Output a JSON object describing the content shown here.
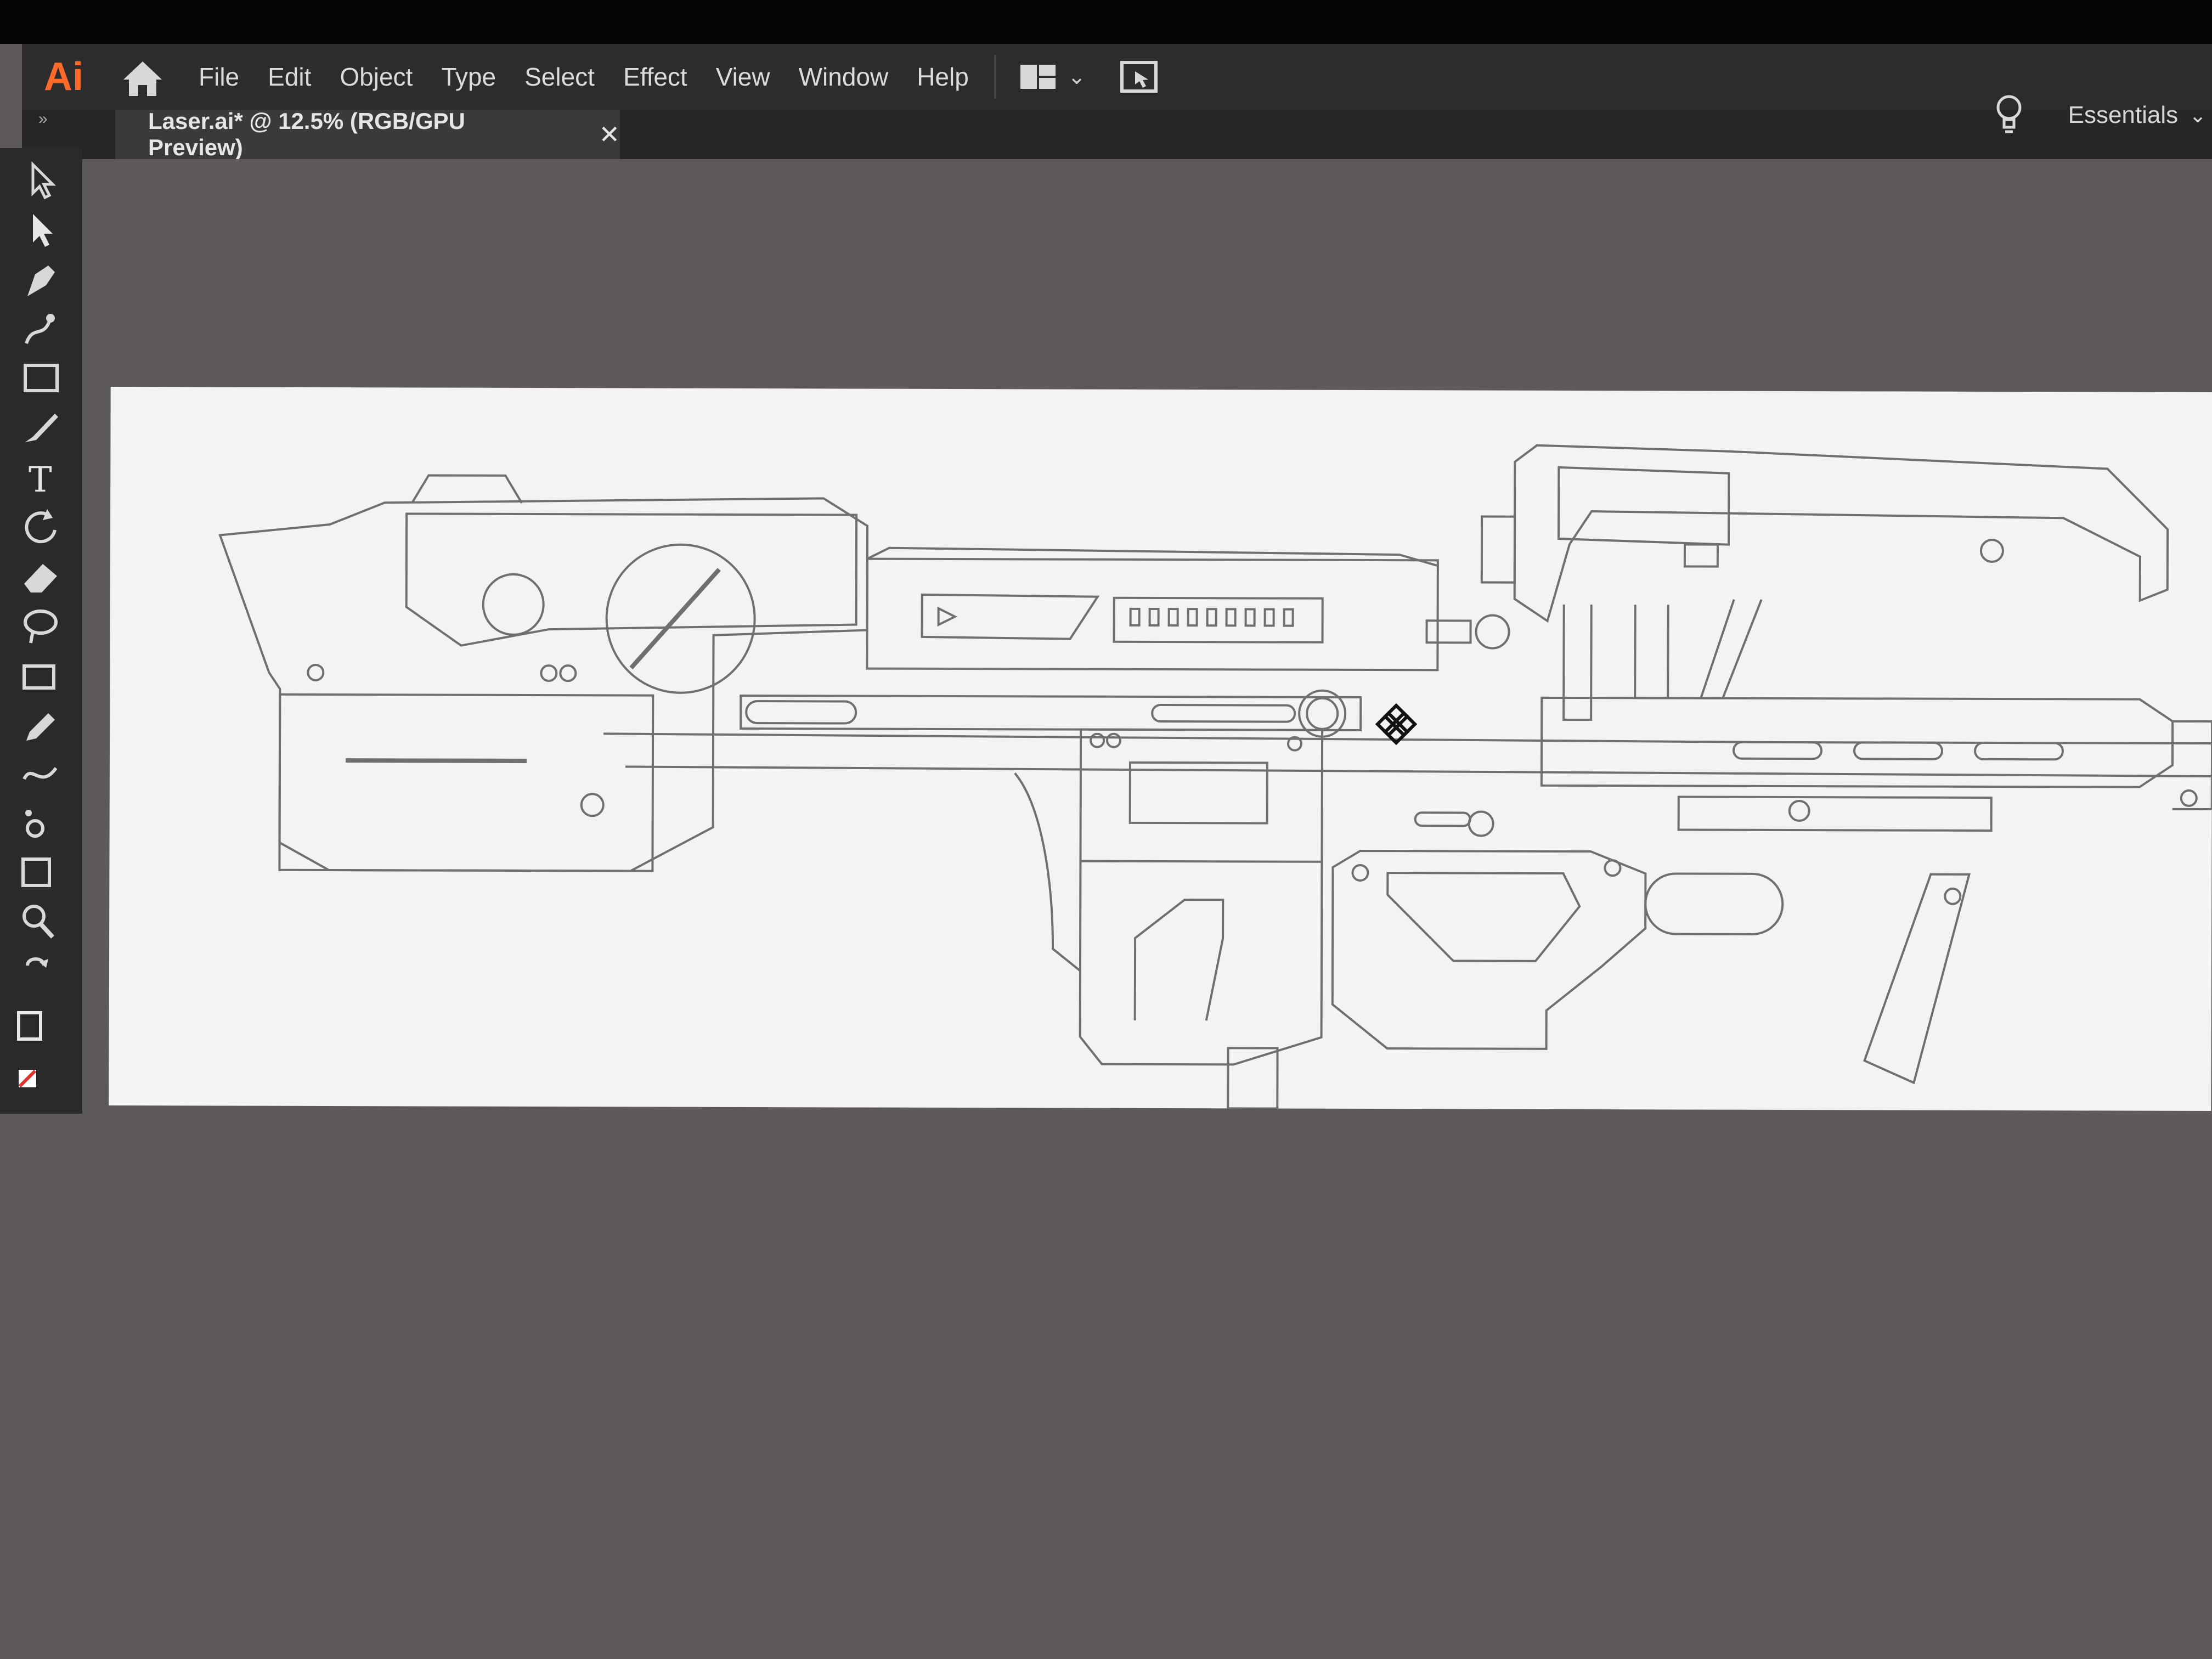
{
  "app": {
    "logo": "Ai"
  },
  "menu": [
    "File",
    "Edit",
    "Object",
    "Type",
    "Select",
    "Effect",
    "View",
    "Window",
    "Help"
  ],
  "document_tab": {
    "title": "Laser.ai* @ 12.5% (RGB/GPU Preview)",
    "close": "✕"
  },
  "workspace": {
    "label": "Essentials",
    "chevron": "⌄"
  },
  "icons": {
    "home": "home-icon",
    "workspace_switcher": "workspace-switcher-icon",
    "arrange": "arrange-documents-icon",
    "discover": "lightbulb-icon"
  },
  "tools": [
    "selection-tool",
    "direct-selection-tool",
    "pen-tool",
    "curvature-tool",
    "rectangle-tool",
    "paintbrush-tool",
    "type-tool",
    "rotate-tool",
    "eraser-tool",
    "lasso-tool",
    "shape-builder-tool",
    "eyedropper-tool",
    "blend-tool",
    "symbol-sprayer-tool",
    "artboard-tool",
    "zoom-tool",
    "swap-fill-stroke",
    "fill-stroke-swatch",
    "none-swatch"
  ],
  "colors": {
    "app_orange": "#ff6a2b",
    "ui_dark": "#2c2c2c",
    "canvas_gray": "#5e5a59",
    "artboard": "#f2f3f2",
    "stroke": "#6f6f6f"
  }
}
